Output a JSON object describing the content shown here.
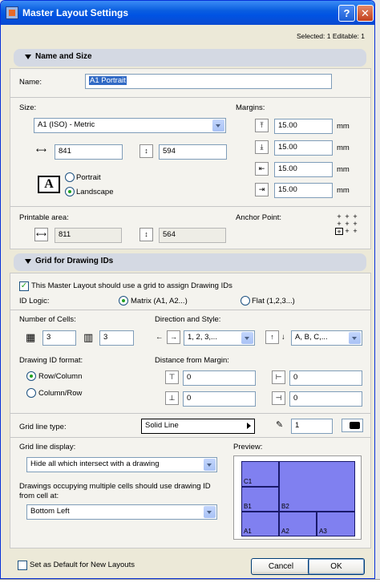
{
  "window": {
    "title": "Master Layout Settings",
    "help_label": "?",
    "close_label": "✕"
  },
  "selection_info": "Selected: 1 Editable: 1",
  "name_size": {
    "header": "Name and Size",
    "name_label": "Name:",
    "name_value": "A1 Portrait",
    "size_label": "Size:",
    "size_value": "A1 (ISO) - Metric",
    "width_value": "841",
    "height_value": "594",
    "orientation_options": [
      "Portrait",
      "Landscape"
    ],
    "orientation_selected": "Landscape",
    "margins_label": "Margins:",
    "margins": [
      "15.00",
      "15.00",
      "15.00",
      "15.00"
    ],
    "margin_unit": "mm",
    "printable_label": "Printable area:",
    "printable_width": "811",
    "printable_height": "564",
    "anchor_label": "Anchor Point:"
  },
  "grid": {
    "header": "Grid for Drawing IDs",
    "use_grid_label": "This Master Layout should use a grid to assign Drawing IDs",
    "use_grid_checked": true,
    "id_logic_label": "ID Logic:",
    "id_logic_options": [
      "Matrix (A1, A2...)",
      "Flat (1,2,3...)"
    ],
    "id_logic_selected": "Matrix (A1, A2...)",
    "cells_label": "Number of Cells:",
    "cells_columns": "3",
    "cells_rows": "3",
    "direction_label": "Direction and Style:",
    "direction_numbers": "1, 2, 3,...",
    "direction_letters": "A, B, C,...",
    "format_label": "Drawing ID format:",
    "format_options": [
      "Row/Column",
      "Column/Row"
    ],
    "format_selected": "Row/Column",
    "distance_label": "Distance from Margin:",
    "distances": [
      "0",
      "0",
      "0",
      "0"
    ],
    "line_type_label": "Grid line type:",
    "line_type_value": "Solid Line",
    "pen_value": "1",
    "line_display_label": "Grid line display:",
    "line_display_value": "Hide all which intersect with a drawing",
    "multi_cell_label": "Drawings occupying multiple cells should use drawing ID from cell at:",
    "multi_cell_value": "Bottom Left",
    "preview_label": "Preview:",
    "preview_cells": [
      "C1",
      "B1",
      "B2",
      "A1",
      "A2",
      "A3"
    ],
    "preview_color": "#8080f0"
  },
  "footer": {
    "default_label": "Set as Default for New Layouts",
    "cancel_label": "Cancel",
    "ok_label": "OK"
  },
  "colors": {
    "title_bar": "#0a5ee0",
    "selection": "#316ac5",
    "radio_dot": "#21a121"
  }
}
